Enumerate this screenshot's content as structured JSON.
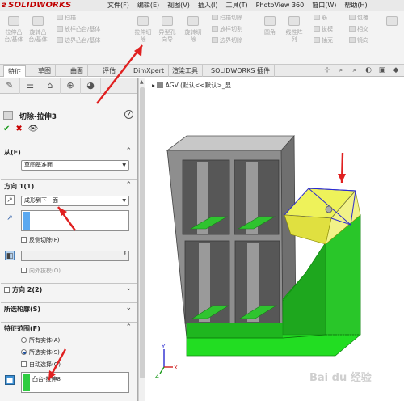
{
  "app": {
    "logo": "SOLIDWORKS"
  },
  "menus": [
    "文件(F)",
    "编辑(E)",
    "视图(V)",
    "插入(I)",
    "工具(T)",
    "PhotoView 360",
    "窗口(W)",
    "帮助(H)"
  ],
  "ribbon": {
    "extrude_boss": "拉伸凸\n台/基体",
    "revolve_boss": "旋转凸\n台/基体",
    "sweep": "扫描",
    "loft_boss": "放样凸台/基体",
    "boundary_boss": "边界凸台/基体",
    "extrude_cut": "拉伸切\n除",
    "hole_wizard": "异型孔\n向导",
    "revolve_cut": "旋转切\n除",
    "sweep_cut": "扫描切除",
    "loft_cut": "放样切割",
    "boundary_cut": "边界切除",
    "fillet": "圆角",
    "linear_pattern": "线性阵\n列",
    "rib": "筋",
    "draft": "拔模",
    "shell": "抽壳",
    "wrap": "包覆",
    "intersect": "相交",
    "mirror": "镜向"
  },
  "tabs": [
    "特征",
    "草图",
    "曲面",
    "评估",
    "DimXpert",
    "渲染工具",
    "SOLIDWORKS 插件"
  ],
  "feature": {
    "title": "切除-拉伸3"
  },
  "from": {
    "label": "从(F)",
    "value": "草图基准面"
  },
  "direction1": {
    "label": "方向 1(1)",
    "end_condition": "成形到下一面",
    "flip_side": "反侧切除(F)",
    "draft_outward": "向外拔模(O)"
  },
  "direction2": {
    "label": "方向 2(2)"
  },
  "contours": {
    "label": "所选轮廓(S)"
  },
  "scope": {
    "label": "特征范围(F)",
    "all_bodies": "所有实体(A)",
    "selected_bodies": "所选实体(S)",
    "auto_select": "自动选择(O)",
    "body_item": "凸台-拉伸8"
  },
  "tree": {
    "part": "AGV (默认<<默认>_显..."
  },
  "watermark": "Bai du 经验"
}
